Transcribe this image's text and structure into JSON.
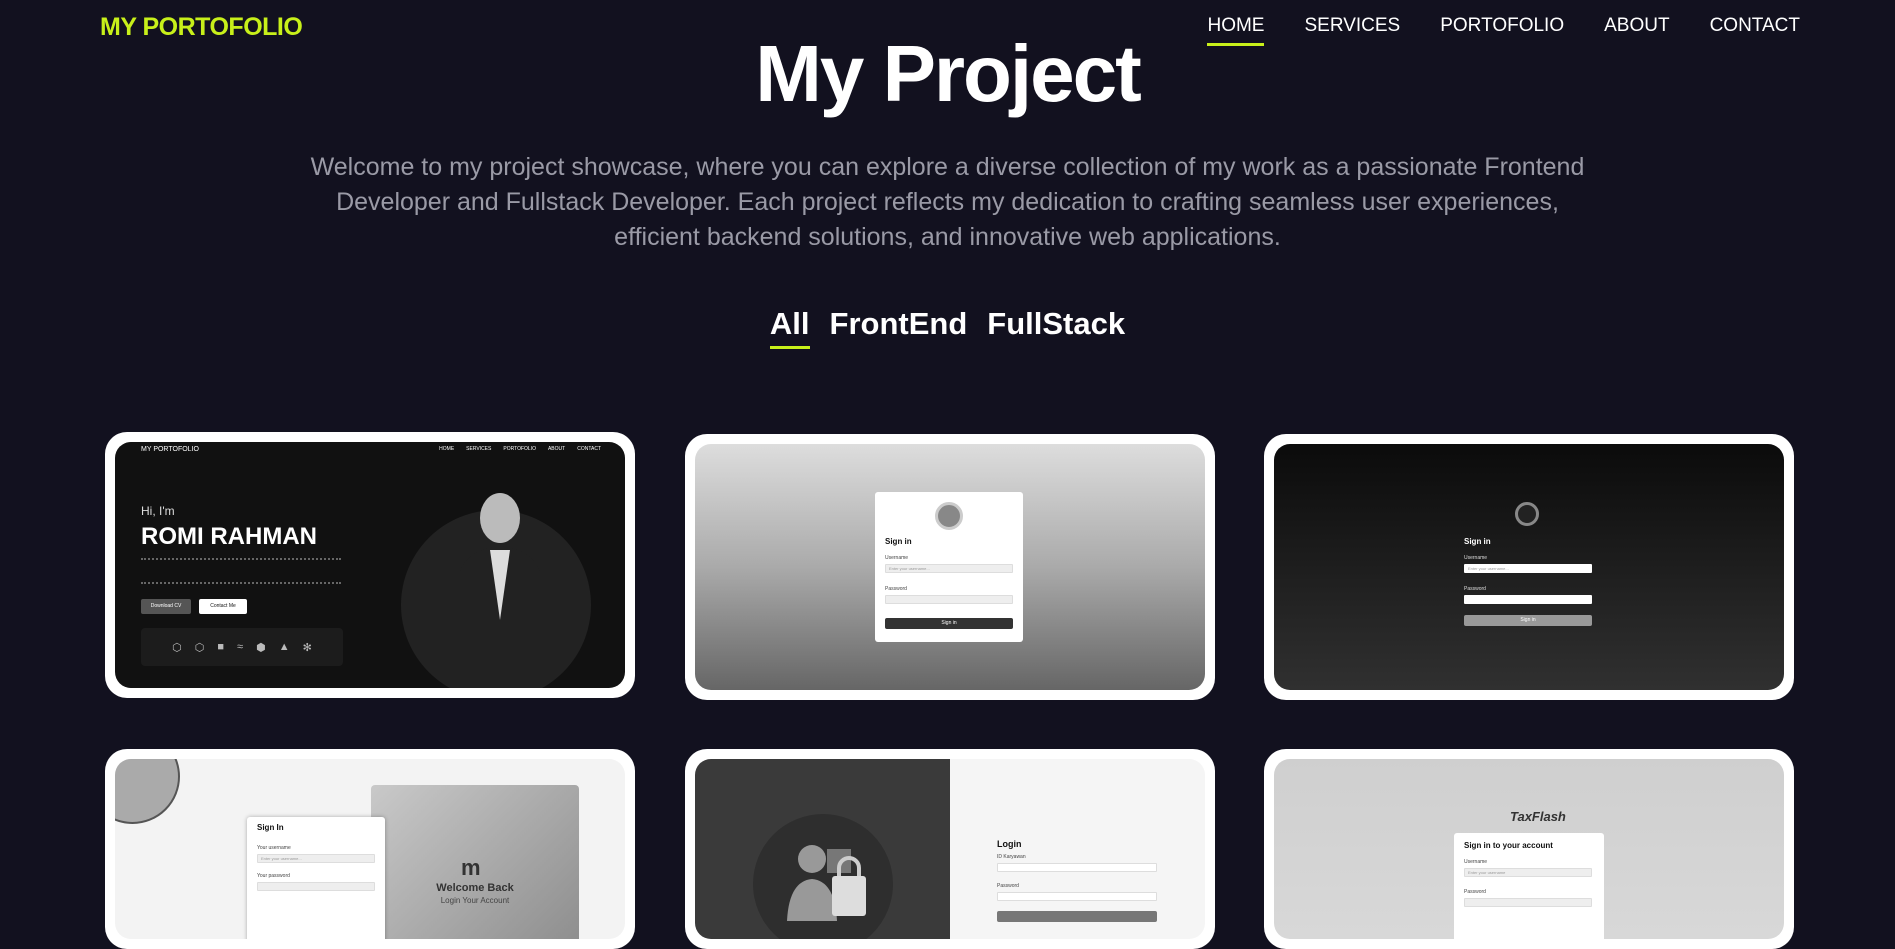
{
  "nav": {
    "logo": "MY PORTOFOLIO",
    "items": [
      "HOME",
      "SERVICES",
      "PORTOFOLIO",
      "ABOUT",
      "CONTACT"
    ],
    "active": "HOME"
  },
  "hero": {
    "title": "My Project",
    "intro": "Welcome to my project showcase, where you can explore a diverse collection of my work as a passionate Frontend Developer and Fullstack Developer. Each project reflects my dedication to crafting seamless user experiences, efficient backend solutions, and innovative web applications."
  },
  "filters": {
    "items": [
      "All",
      "FrontEnd",
      "FullStack"
    ],
    "active": "All"
  },
  "accent": "#c8f01a",
  "projects": {
    "p1": {
      "logo": "MY PORTOFOLIO",
      "menu": [
        "HOME",
        "SERVICES",
        "PORTOFOLIO",
        "ABOUT",
        "CONTACT"
      ],
      "greeting": "Hi, I'm",
      "name": "ROMI RAHMAN",
      "download": "Download CV",
      "contact": "Contact Me"
    },
    "p2": {
      "heading": "Sign in",
      "user_label": "Username",
      "user_ph": "Enter your username...",
      "pass_label": "Password",
      "button": "Sign in"
    },
    "p3": {
      "heading": "Sign in",
      "user_label": "Username",
      "user_ph": "Enter your username...",
      "pass_label": "Password",
      "button": "Sign in"
    },
    "p4": {
      "heading": "Sign In",
      "user_label": "Your username",
      "user_ph": "Enter your username...",
      "pass_label": "Your password",
      "welcome": "Welcome Back",
      "sub": "Login Your Account"
    },
    "p5": {
      "heading": "Login",
      "id_label": "ID Karyawan",
      "pass_label": "Password"
    },
    "p6": {
      "brand": "TaxFlash",
      "heading": "Sign in to your account",
      "user_label": "Username",
      "user_ph": "Enter your username",
      "pass_label": "Password"
    }
  }
}
